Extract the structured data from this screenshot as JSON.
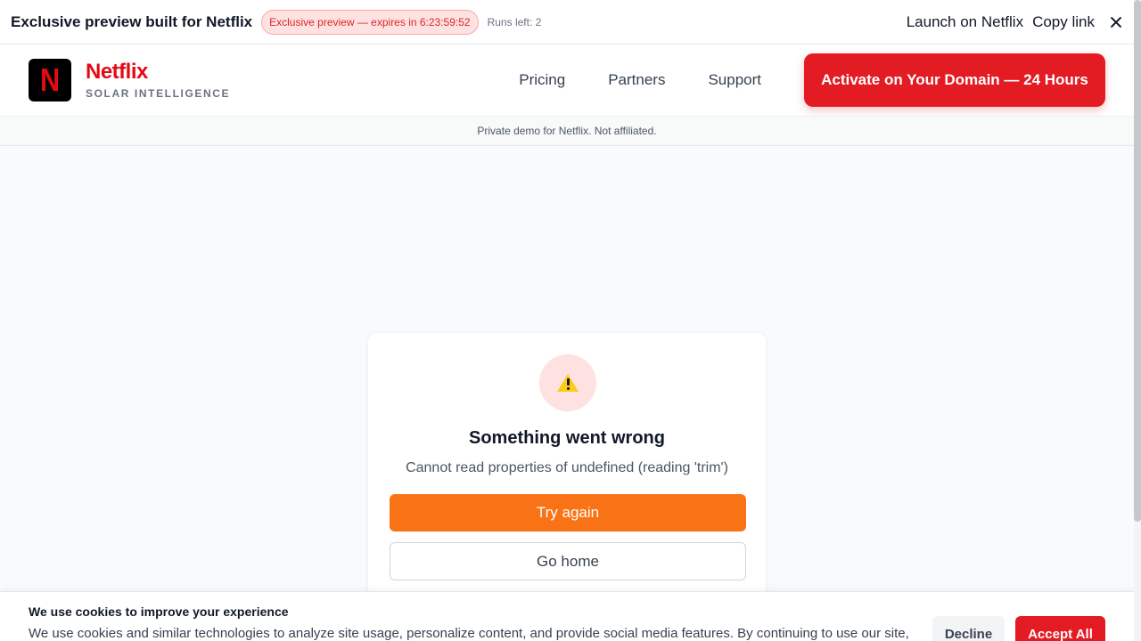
{
  "topbar": {
    "title": "Exclusive preview built for Netflix",
    "expiry_badge": "Exclusive preview — expires in 6:23:59:52",
    "runs_left": "Runs left: 2",
    "launch_link": "Launch on Netflix",
    "copy_link": "Copy link",
    "close_icon": "close-icon"
  },
  "header": {
    "logo_letter": "N",
    "brand_name": "Netflix",
    "brand_sub": "SOLAR INTELLIGENCE",
    "nav": [
      "Pricing",
      "Partners",
      "Support"
    ],
    "cta_label": "Activate on Your Domain — 24 Hours"
  },
  "disclaimer": "Private demo for Netflix. Not affiliated.",
  "error": {
    "icon": "warning-icon",
    "title": "Something went wrong",
    "message": "Cannot read properties of undefined (reading 'trim')",
    "try_again": "Try again",
    "go_home": "Go home"
  },
  "cookie": {
    "title": "We use cookies to improve your experience",
    "text": "We use cookies and similar technologies to analyze site usage, personalize content, and provide social media features. By continuing to use our site,",
    "decline": "Decline",
    "accept": "Accept All"
  },
  "colors": {
    "brand_red": "#e50914",
    "cta_red": "#e31b23",
    "orange": "#f97316",
    "warning_bg": "#fee2e2"
  }
}
